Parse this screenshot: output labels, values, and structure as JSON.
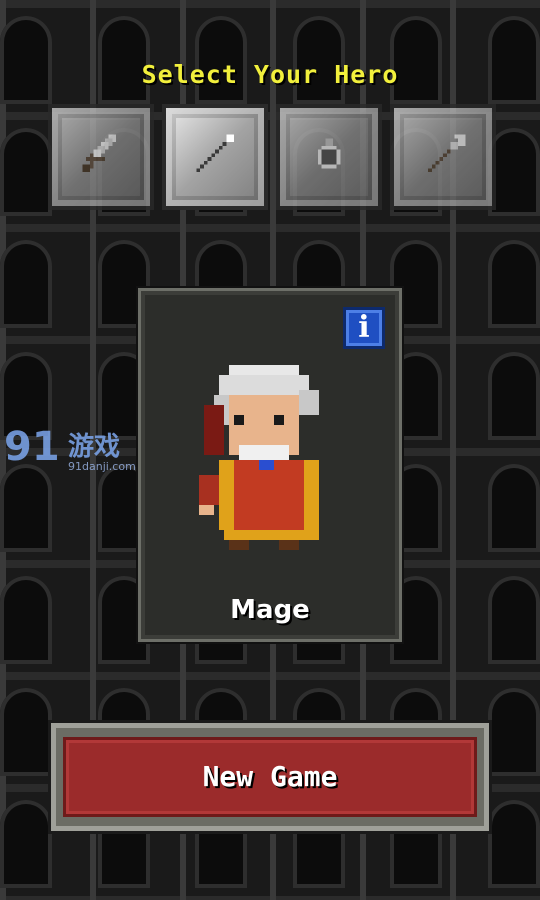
{
  "screen": {
    "title": "Select Your Hero"
  },
  "classes": [
    {
      "name": "warrior",
      "icon": "sword-icon",
      "selected": false
    },
    {
      "name": "mage",
      "icon": "staff-icon",
      "selected": true
    },
    {
      "name": "rogue",
      "icon": "ring-icon",
      "selected": false
    },
    {
      "name": "huntress",
      "icon": "spear-icon",
      "selected": false
    }
  ],
  "hero": {
    "name": "Mage",
    "info_label": "i"
  },
  "actions": {
    "new_game_label": "New Game"
  },
  "watermark": {
    "number": "91",
    "brand": "游戏",
    "url": "91danji.com"
  },
  "colors": {
    "title": "#f2f03c",
    "button_red": "#9b2b2b",
    "info_blue": "#1f4fc2"
  }
}
